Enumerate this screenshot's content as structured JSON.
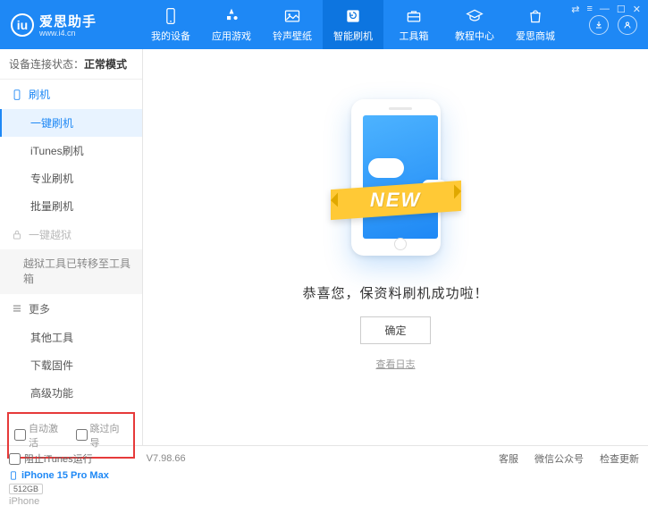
{
  "app": {
    "name": "爱思助手",
    "url": "www.i4.cn"
  },
  "nav": {
    "items": [
      {
        "label": "我的设备"
      },
      {
        "label": "应用游戏"
      },
      {
        "label": "铃声壁纸"
      },
      {
        "label": "智能刷机"
      },
      {
        "label": "工具箱"
      },
      {
        "label": "教程中心"
      },
      {
        "label": "爱思商城"
      }
    ]
  },
  "status": {
    "prefix": "设备连接状态：",
    "mode": "正常模式"
  },
  "sidebar": {
    "cat_flash": "刷机",
    "items_flash": [
      {
        "label": "一键刷机"
      },
      {
        "label": "iTunes刷机"
      },
      {
        "label": "专业刷机"
      },
      {
        "label": "批量刷机"
      }
    ],
    "cat_jailbreak": "一键越狱",
    "jailbreak_note": "越狱工具已转移至工具箱",
    "cat_more": "更多",
    "items_more": [
      {
        "label": "其他工具"
      },
      {
        "label": "下载固件"
      },
      {
        "label": "高级功能"
      }
    ]
  },
  "options": {
    "auto_activate": "自动激活",
    "skip_guide": "跳过向导"
  },
  "device": {
    "name": "iPhone 15 Pro Max",
    "capacity": "512GB",
    "type": "iPhone"
  },
  "main": {
    "banner": "NEW",
    "success": "恭喜您，保资料刷机成功啦！",
    "ok": "确定",
    "log": "查看日志"
  },
  "footer": {
    "block_itunes": "阻止iTunes运行",
    "version": "V7.98.66",
    "links": [
      "客服",
      "微信公众号",
      "检查更新"
    ]
  }
}
